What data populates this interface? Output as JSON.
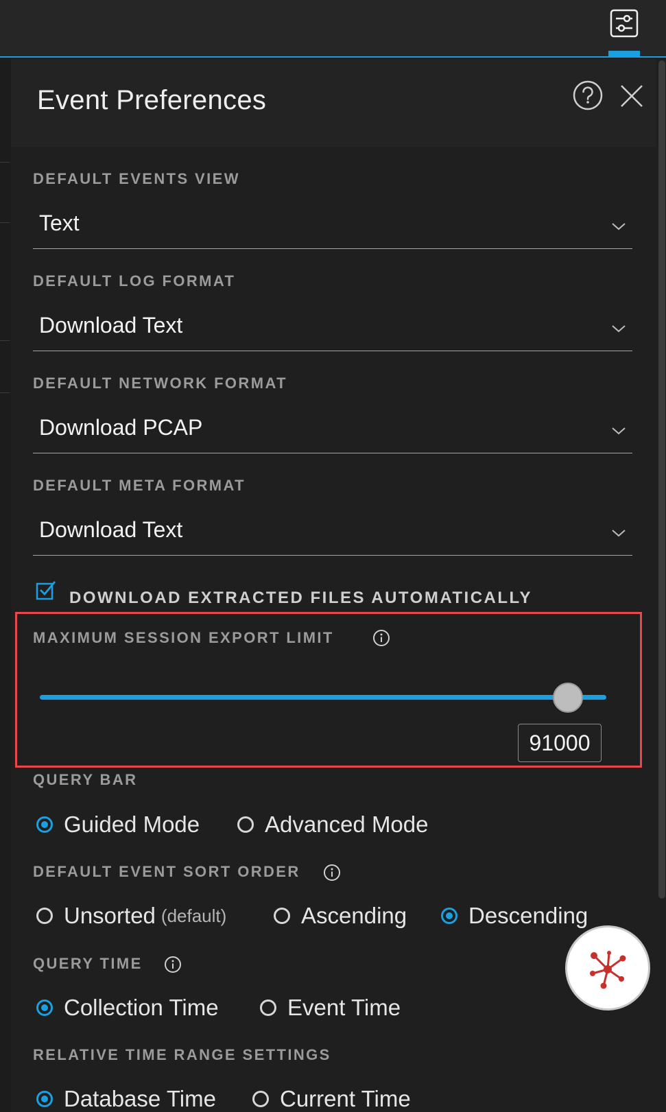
{
  "panel": {
    "title": "Event Preferences"
  },
  "default_events_view": {
    "label": "DEFAULT EVENTS VIEW",
    "value": "Text"
  },
  "default_log_format": {
    "label": "DEFAULT LOG FORMAT",
    "value": "Download Text"
  },
  "default_network_format": {
    "label": "DEFAULT NETWORK FORMAT",
    "value": "Download PCAP"
  },
  "default_meta_format": {
    "label": "DEFAULT META FORMAT",
    "value": "Download Text"
  },
  "download_extracted": {
    "label": "DOWNLOAD EXTRACTED FILES AUTOMATICALLY",
    "checked": true
  },
  "max_session_export": {
    "label": "MAXIMUM SESSION EXPORT LIMIT",
    "value": "91000"
  },
  "query_bar": {
    "label": "QUERY BAR",
    "options": [
      {
        "label": "Guided Mode",
        "selected": true
      },
      {
        "label": "Advanced Mode",
        "selected": false
      }
    ]
  },
  "sort_order": {
    "label": "DEFAULT EVENT SORT ORDER",
    "options": [
      {
        "label": "Unsorted",
        "sub": "(default)",
        "selected": false
      },
      {
        "label": "Ascending",
        "selected": false
      },
      {
        "label": "Descending",
        "selected": true
      }
    ]
  },
  "query_time": {
    "label": "QUERY TIME",
    "options": [
      {
        "label": "Collection Time",
        "selected": true
      },
      {
        "label": "Event Time",
        "selected": false
      }
    ]
  },
  "relative_time": {
    "label": "RELATIVE TIME RANGE SETTINGS",
    "options": [
      {
        "label": "Database Time",
        "selected": true
      },
      {
        "label": "Current Time",
        "selected": false
      }
    ]
  },
  "icons": {
    "prefs_toggle": "sliders-icon",
    "help": "question-circle-icon",
    "close": "close-icon",
    "info": "info-circle-icon",
    "caret": "chevron-down-icon",
    "fab": "network-graph-icon"
  },
  "colors": {
    "accent": "#1a9fe0",
    "highlight": "#e8474c",
    "background": "#1f1f1f",
    "fab_icon": "#c9302c"
  }
}
